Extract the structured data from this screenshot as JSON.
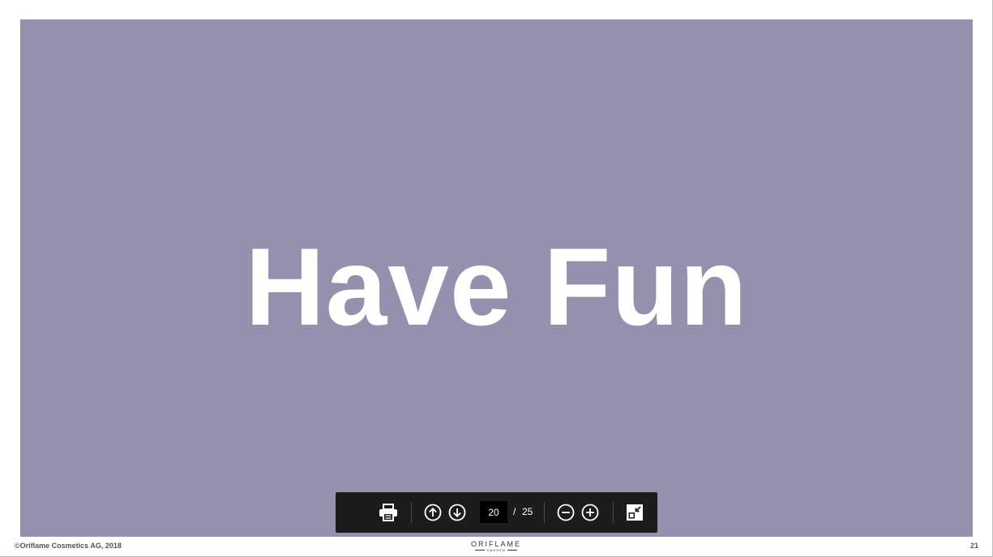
{
  "slide": {
    "title": "Have Fun",
    "background_color": "#9490ae"
  },
  "footer": {
    "copyright": "©Oriflame Cosmetics AG, 2018",
    "logo_text": "ORIFLAME",
    "logo_subtext": "SWEDEN",
    "page_number": "21"
  },
  "toolbar": {
    "print_icon": "printer-icon",
    "prev_icon": "arrow-up-circle-icon",
    "next_icon": "arrow-down-circle-icon",
    "current_page": "20",
    "page_separator": "/",
    "total_pages": "25",
    "zoom_out_icon": "minus-circle-icon",
    "zoom_in_icon": "plus-circle-icon",
    "fullscreen_icon": "exit-fullscreen-icon"
  }
}
